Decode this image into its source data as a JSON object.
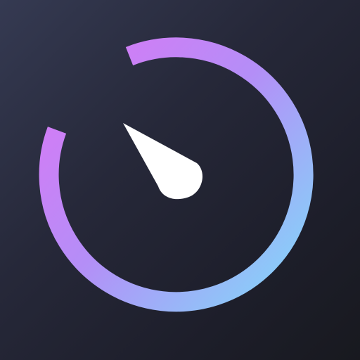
{
  "icon": {
    "name": "stopwatch-timer-app-icon",
    "background_gradient": [
      "#353a52",
      "#262839",
      "#18191f"
    ],
    "ring_gradient": [
      "#d07cf4",
      "#b28cf6",
      "#8fcdf8"
    ],
    "needle_color": "#ffffff"
  }
}
